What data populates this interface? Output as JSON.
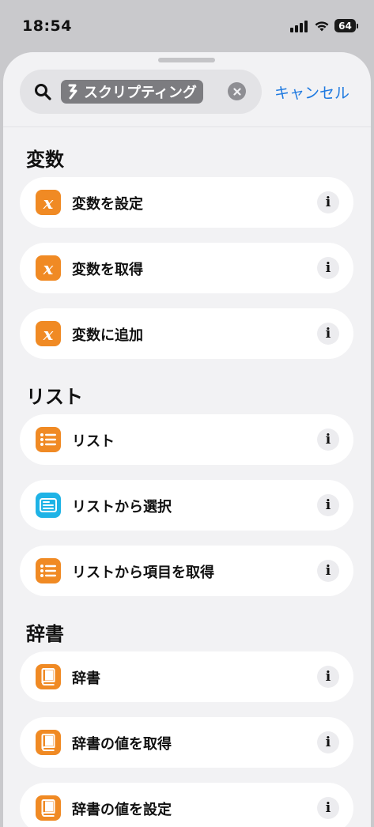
{
  "status": {
    "time": "18:54",
    "battery": "64"
  },
  "search": {
    "token_label": "スクリプティング",
    "cancel_label": "キャンセル"
  },
  "sections": {
    "variables": {
      "title": "変数",
      "items": [
        {
          "label": "変数を設定",
          "icon": "variable-icon",
          "glyph": "x"
        },
        {
          "label": "変数を取得",
          "icon": "variable-icon",
          "glyph": "x"
        },
        {
          "label": "変数に追加",
          "icon": "variable-icon",
          "glyph": "x"
        }
      ]
    },
    "list": {
      "title": "リスト",
      "items": [
        {
          "label": "リスト",
          "icon": "list-icon"
        },
        {
          "label": "リストから選択",
          "icon": "choose-from-list-icon"
        },
        {
          "label": "リストから項目を取得",
          "icon": "list-icon"
        }
      ]
    },
    "dictionary": {
      "title": "辞書",
      "items": [
        {
          "label": "辞書",
          "icon": "book-icon"
        },
        {
          "label": "辞書の値を取得",
          "icon": "book-icon"
        },
        {
          "label": "辞書の値を設定",
          "icon": "book-icon"
        }
      ]
    }
  },
  "info_glyph": "i",
  "colors": {
    "accent": "#1f7ae0",
    "orange": "#f08a24",
    "cyan": "#1fb3e6"
  }
}
